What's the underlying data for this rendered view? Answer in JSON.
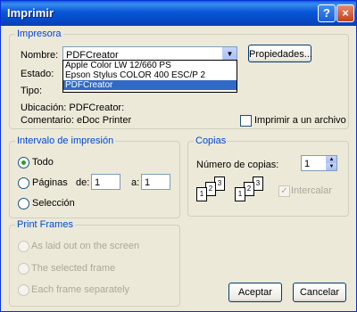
{
  "window": {
    "title": "Imprimir",
    "help_label": "?",
    "close_label": "×"
  },
  "printer": {
    "group_label": "Impresora",
    "name_label": "Nombre:",
    "name_value": "PDFCreator",
    "properties_button": "Propiedades...",
    "dropdown_options": [
      "Apple Color LW 12/660 PS",
      "Epson Stylus COLOR 400 ESC/P 2",
      "PDFCreator"
    ],
    "selected_option": "PDFCreator",
    "status_label": "Estado:",
    "type_label": "Tipo:",
    "location_label": "Ubicación: PDFCreator:",
    "comment_label": "Comentario: eDoc Printer",
    "print_to_file_label": "Imprimir a un archivo"
  },
  "range": {
    "group_label": "Intervalo de impresión",
    "all_label": "Todo",
    "pages_label": "Páginas",
    "from_label": "de:",
    "from_value": "1",
    "to_label": "a:",
    "to_value": "1",
    "selection_label": "Selección"
  },
  "copies": {
    "group_label": "Copias",
    "count_label": "Número de copias:",
    "count_value": "1",
    "collate_label": "Intercalar",
    "page_numbers": [
      "1",
      "2",
      "3"
    ]
  },
  "frames": {
    "group_label": "Print Frames",
    "options": [
      "As laid out on the screen",
      "The selected frame",
      "Each frame separately"
    ]
  },
  "buttons": {
    "accept": "Aceptar",
    "cancel": "Cancelar"
  }
}
